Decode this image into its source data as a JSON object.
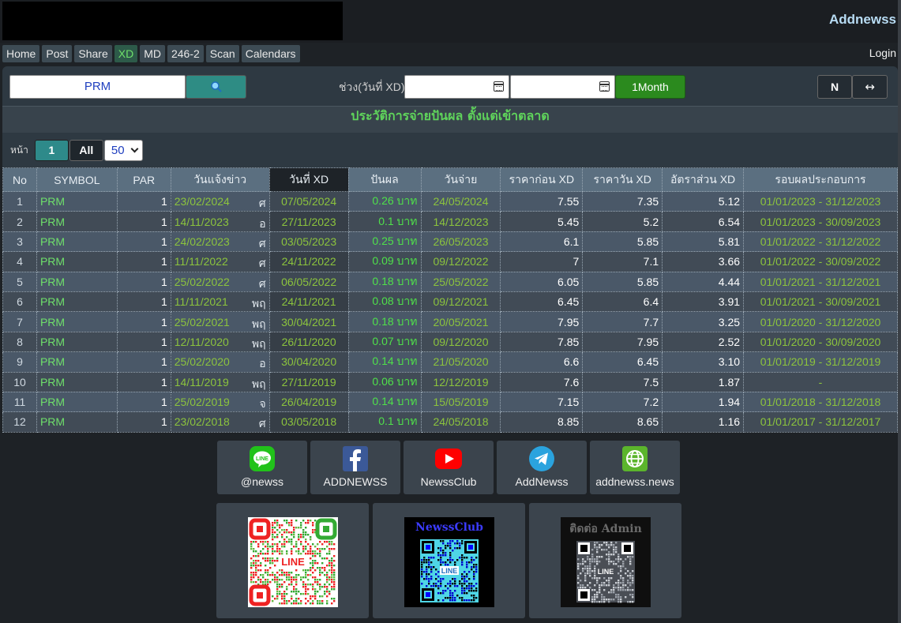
{
  "brand": "Addnewss",
  "login": "Login",
  "menu": [
    "Home",
    "Post",
    "Share",
    "XD",
    "MD",
    "246-2",
    "Scan",
    "Calendars"
  ],
  "menu_active": "XD",
  "search": {
    "value": "PRM"
  },
  "range_label": "ช่วง(วันที่ XD)",
  "month_button": "1Month",
  "n_button": "N",
  "expand_button": "↔",
  "section_title": "ประวัติการจ่ายปันผล ตั้งแต่เข้าตลาด",
  "pager": {
    "label": "หน้า",
    "page": "1",
    "all": "All",
    "per_page": "50"
  },
  "table": {
    "headers": [
      "No",
      "SYMBOL",
      "PAR",
      "วันแจ้งข่าว",
      "วันที่ XD",
      "ปันผล",
      "วันจ่าย",
      "ราคาก่อน XD",
      "ราคาวัน XD",
      "อัตราส่วน XD",
      "รอบผลประกอบการ"
    ],
    "rows": [
      [
        "1",
        "PRM",
        "1",
        "23/02/2024",
        "ศ",
        "07/05/2024",
        "0.26 บาท",
        "24/05/2024",
        "7.55",
        "7.35",
        "5.12",
        "01/01/2023 - 31/12/2023"
      ],
      [
        "2",
        "PRM",
        "1",
        "14/11/2023",
        "อ",
        "27/11/2023",
        "0.1 บาท",
        "14/12/2023",
        "5.45",
        "5.2",
        "6.54",
        "01/01/2023 - 30/09/2023"
      ],
      [
        "3",
        "PRM",
        "1",
        "24/02/2023",
        "ศ",
        "03/05/2023",
        "0.25 บาท",
        "26/05/2023",
        "6.1",
        "5.85",
        "5.81",
        "01/01/2022 - 31/12/2022"
      ],
      [
        "4",
        "PRM",
        "1",
        "11/11/2022",
        "ศ",
        "24/11/2022",
        "0.09 บาท",
        "09/12/2022",
        "7",
        "7.1",
        "3.66",
        "01/01/2022 - 30/09/2022"
      ],
      [
        "5",
        "PRM",
        "1",
        "25/02/2022",
        "ศ",
        "06/05/2022",
        "0.18 บาท",
        "25/05/2022",
        "6.05",
        "5.85",
        "4.44",
        "01/01/2021 - 31/12/2021"
      ],
      [
        "6",
        "PRM",
        "1",
        "11/11/2021",
        "พฤ",
        "24/11/2021",
        "0.08 บาท",
        "09/12/2021",
        "6.45",
        "6.4",
        "3.91",
        "01/01/2021 - 30/09/2021"
      ],
      [
        "7",
        "PRM",
        "1",
        "25/02/2021",
        "พฤ",
        "30/04/2021",
        "0.18 บาท",
        "20/05/2021",
        "7.95",
        "7.7",
        "3.25",
        "01/01/2020 - 31/12/2020"
      ],
      [
        "8",
        "PRM",
        "1",
        "12/11/2020",
        "พฤ",
        "26/11/2020",
        "0.07 บาท",
        "09/12/2020",
        "7.85",
        "7.95",
        "2.52",
        "01/01/2020 - 30/09/2020"
      ],
      [
        "9",
        "PRM",
        "1",
        "25/02/2020",
        "อ",
        "30/04/2020",
        "0.14 บาท",
        "21/05/2020",
        "6.6",
        "6.45",
        "3.10",
        "01/01/2019 - 31/12/2019"
      ],
      [
        "10",
        "PRM",
        "1",
        "14/11/2019",
        "พฤ",
        "27/11/2019",
        "0.06 บาท",
        "12/12/2019",
        "7.6",
        "7.5",
        "1.87",
        "-"
      ],
      [
        "11",
        "PRM",
        "1",
        "25/02/2019",
        "จ",
        "26/04/2019",
        "0.14 บาท",
        "15/05/2019",
        "7.15",
        "7.2",
        "1.94",
        "01/01/2018 - 31/12/2018"
      ],
      [
        "12",
        "PRM",
        "1",
        "23/02/2018",
        "ศ",
        "03/05/2018",
        "0.1 บาท",
        "24/05/2018",
        "8.85",
        "8.65",
        "1.16",
        "01/01/2017 - 31/12/2017"
      ]
    ]
  },
  "socials": [
    {
      "label": "@newss",
      "icon": "line-icon",
      "color": "#21c21a"
    },
    {
      "label": "ADDNEWSS",
      "icon": "facebook-icon",
      "color": "#3b5998"
    },
    {
      "label": "NewssClub",
      "icon": "youtube-icon",
      "color": "#ff0000"
    },
    {
      "label": "AddNewss",
      "icon": "telegram-icon",
      "color": "#2aa3de"
    },
    {
      "label": "addnewss.news",
      "icon": "globe-icon",
      "color": "#5bb52c"
    }
  ],
  "qr": [
    {
      "name": "line-qr",
      "caption": "LINE"
    },
    {
      "name": "newssclub-qr",
      "title": "NewssClub",
      "caption": "LINE"
    },
    {
      "name": "admin-qr",
      "title": "ติดต่อ Admin",
      "caption": "LINE"
    }
  ]
}
